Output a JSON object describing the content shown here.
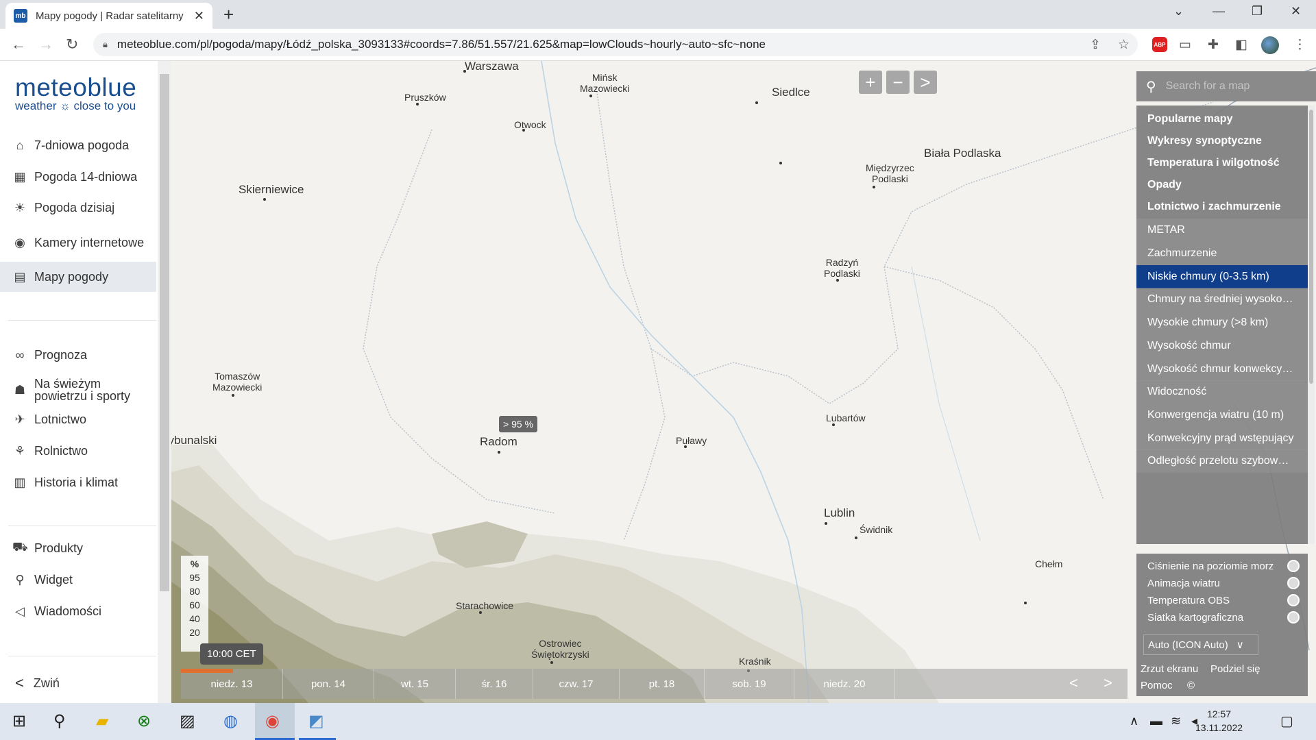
{
  "browser": {
    "tab_title": "Mapy pogody | Radar satelitarny",
    "favicon_text": "mb",
    "url": "meteoblue.com/pl/pogoda/mapy/Łódź_polska_3093133#coords=7.86/51.557/21.625&map=lowClouds~hourly~auto~sfc~none",
    "abp_label": "ABP"
  },
  "sidebar": {
    "logo_brand": "meteoblue",
    "logo_tagline": "weather ☼ close to you",
    "items": [
      {
        "label": "7-dniowa pogoda",
        "icon": "home-icon",
        "glyph": "⌂"
      },
      {
        "label": "Pogoda 14-dniowa",
        "icon": "calendar-14-icon",
        "glyph": "▦"
      },
      {
        "label": "Pogoda dzisiaj",
        "icon": "sun-cloud-icon",
        "glyph": "☀"
      },
      {
        "label": "Kamery internetowe",
        "icon": "webcam-icon",
        "glyph": "◉"
      },
      {
        "label": "Mapy pogody",
        "icon": "map-icon",
        "glyph": "▤"
      },
      {
        "label": "Prognoza",
        "icon": "binoculars-icon",
        "glyph": "∞"
      },
      {
        "label": "Na świeżym powietrzu i sporty",
        "icon": "hiker-icon",
        "glyph": "☗"
      },
      {
        "label": "Lotnictwo",
        "icon": "plane-icon",
        "glyph": "✈"
      },
      {
        "label": "Rolnictwo",
        "icon": "wheat-icon",
        "glyph": "⚘"
      },
      {
        "label": "Historia i klimat",
        "icon": "table-icon",
        "glyph": "▥"
      },
      {
        "label": "Produkty",
        "icon": "cart-icon",
        "glyph": "⛟"
      },
      {
        "label": "Widget",
        "icon": "widget-icon",
        "glyph": "⚲"
      },
      {
        "label": "Wiadomości",
        "icon": "megaphone-icon",
        "glyph": "◁"
      }
    ],
    "collapse_label": "Zwiń"
  },
  "map": {
    "cities": [
      {
        "name": "Warszawa",
        "size": "med"
      },
      {
        "name": "Pruszków",
        "size": "small"
      },
      {
        "name": "Mińsk\nMazowiecki",
        "size": "small"
      },
      {
        "name": "Otwock",
        "size": "small"
      },
      {
        "name": "Siedlce",
        "size": "med"
      },
      {
        "name": "Biała Podlaska",
        "size": "med"
      },
      {
        "name": "Międzyrzec\nPodlaski",
        "size": "small"
      },
      {
        "name": "Skierniewice",
        "size": "med"
      },
      {
        "name": "Radzyń\nPodlaski",
        "size": "small"
      },
      {
        "name": "Tomaszów\nMazowiecki",
        "size": "small"
      },
      {
        "name": "ów Trybunalski",
        "size": "med"
      },
      {
        "name": "Radom",
        "size": "med"
      },
      {
        "name": "Puławy",
        "size": "small"
      },
      {
        "name": "Lubartów",
        "size": "small"
      },
      {
        "name": "Lublin",
        "size": "med"
      },
      {
        "name": "Świdnik",
        "size": "small"
      },
      {
        "name": "Starachowice",
        "size": "small"
      },
      {
        "name": "Ostrowiec\nŚwiętokrzyski",
        "size": "small"
      },
      {
        "name": "Kraśnik",
        "size": "small"
      },
      {
        "name": "Chełm",
        "size": "small"
      }
    ],
    "value_tooltip": "> 95 %",
    "legend": {
      "unit": "%",
      "levels": [
        "95",
        "80",
        "60",
        "40",
        "20"
      ]
    },
    "timestamp": "10:00 CET",
    "zoom_in": "+",
    "zoom_out": "−",
    "collapse_panel": ">",
    "timeline_progress": 0.055,
    "days": [
      "niedz. 13",
      "pon. 14",
      "wt. 15",
      "śr. 16",
      "czw. 17",
      "pt. 18",
      "sob. 19",
      "niedz. 20"
    ],
    "prev": "<",
    "next": ">"
  },
  "panel": {
    "search_placeholder": "Search for a map",
    "layers": [
      {
        "label": "Popularne mapy",
        "type": "category"
      },
      {
        "label": "Wykresy synoptyczne",
        "type": "category"
      },
      {
        "label": "Temperatura i wilgotność",
        "type": "category"
      },
      {
        "label": "Opady",
        "type": "category"
      },
      {
        "label": "Lotnictwo i zachmurzenie",
        "type": "category"
      },
      {
        "label": "METAR",
        "type": "sub"
      },
      {
        "label": "Zachmurzenie",
        "type": "sub"
      },
      {
        "label": "Niskie chmury (0-3.5 km)",
        "type": "selected"
      },
      {
        "label": "Chmury na średniej wysoko…",
        "type": "sub"
      },
      {
        "label": "Wysokie chmury (>8 km)",
        "type": "sub"
      },
      {
        "label": "Wysokość chmur",
        "type": "sub"
      },
      {
        "label": "Wysokość chmur konwekcy…",
        "type": "sub"
      },
      {
        "label": "Widoczność",
        "type": "sub"
      },
      {
        "label": "Konwergencja wiatru (10 m)",
        "type": "sub"
      },
      {
        "label": "Konwekcyjny prąd wstępujący",
        "type": "sub"
      },
      {
        "label": "Odległość przelotu szybow…",
        "type": "sub"
      }
    ],
    "overlays": [
      {
        "label": "Ciśnienie na poziomie morz"
      },
      {
        "label": "Animacja wiatru"
      },
      {
        "label": "Temperatura OBS"
      },
      {
        "label": "Siatka kartograficzna"
      }
    ],
    "model_select": "Auto (ICON Auto)",
    "links": {
      "screenshot": "Zrzut ekranu",
      "share": "Podziel się",
      "help": "Pomoc",
      "copyright": "©"
    }
  },
  "taskbar": {
    "time": "12:57",
    "date": "13.11.2022"
  }
}
